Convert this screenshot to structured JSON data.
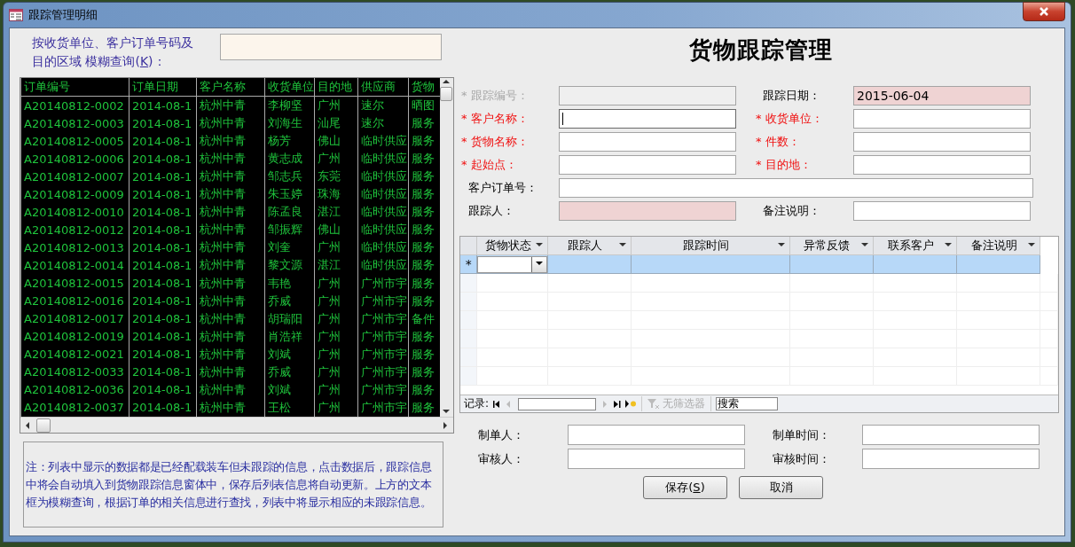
{
  "window": {
    "title": "跟踪管理明细"
  },
  "search": {
    "label_line1": "按收货单位、客户订单号码及",
    "label_before": "目的区域 模糊查询(",
    "mnemonic": "K",
    "label_after": ")："
  },
  "orders": {
    "columns": [
      "订单编号",
      "订单日期",
      "客户名称",
      "收货单位",
      "目的地",
      "供应商",
      "货物"
    ],
    "rows": [
      [
        "A20140812-0002",
        "2014-08-1",
        "杭州中青",
        "李柳坚",
        "广州",
        "速尔",
        "晒图"
      ],
      [
        "A20140812-0003",
        "2014-08-1",
        "杭州中青",
        "刘海生",
        "汕尾",
        "速尔",
        "服务"
      ],
      [
        "A20140812-0005",
        "2014-08-1",
        "杭州中青",
        "杨芳",
        "佛山",
        "临时供应",
        "服务"
      ],
      [
        "A20140812-0006",
        "2014-08-1",
        "杭州中青",
        "黄志成",
        "广州",
        "临时供应",
        "服务"
      ],
      [
        "A20140812-0007",
        "2014-08-1",
        "杭州中青",
        "邹志兵",
        "东莞",
        "临时供应",
        "服务"
      ],
      [
        "A20140812-0009",
        "2014-08-1",
        "杭州中青",
        "朱玉婷",
        "珠海",
        "临时供应",
        "服务"
      ],
      [
        "A20140812-0010",
        "2014-08-1",
        "杭州中青",
        "陈孟良",
        "湛江",
        "临时供应",
        "服务"
      ],
      [
        "A20140812-0012",
        "2014-08-1",
        "杭州中青",
        "邹振辉",
        "佛山",
        "临时供应",
        "服务"
      ],
      [
        "A20140812-0013",
        "2014-08-1",
        "杭州中青",
        "刘奎",
        "广州",
        "临时供应",
        "服务"
      ],
      [
        "A20140812-0014",
        "2014-08-1",
        "杭州中青",
        "黎文源",
        "湛江",
        "临时供应",
        "服务"
      ],
      [
        "A20140812-0015",
        "2014-08-1",
        "杭州中青",
        "韦艳",
        "广州",
        "广州市宇",
        "服务"
      ],
      [
        "A20140812-0016",
        "2014-08-1",
        "杭州中青",
        "乔威",
        "广州",
        "广州市宇",
        "服务"
      ],
      [
        "A20140812-0017",
        "2014-08-1",
        "杭州中青",
        "胡瑞阳",
        "广州",
        "广州市宇",
        "备件"
      ],
      [
        "A20140812-0019",
        "2014-08-1",
        "杭州中青",
        "肖浩祥",
        "广州",
        "广州市宇",
        "服务"
      ],
      [
        "A20140812-0021",
        "2014-08-1",
        "杭州中青",
        "刘斌",
        "广州",
        "广州市宇",
        "服务"
      ],
      [
        "A20140812-0033",
        "2014-08-1",
        "杭州中青",
        "乔威",
        "广州",
        "广州市宇",
        "服务"
      ],
      [
        "A20140812-0036",
        "2014-08-1",
        "杭州中青",
        "刘斌",
        "广州",
        "广州市宇",
        "服务"
      ],
      [
        "A20140812-0037",
        "2014-08-1",
        "杭州中青",
        "王松",
        "广州",
        "广州市宇",
        "服务"
      ]
    ]
  },
  "note": "注：列表中显示的数据都是已经配载装车但未跟踪的信息，点击数据后，跟踪信息中将会自动填入到货物跟踪信息窗体中，保存后列表信息将自动更新。上方的文本框为模糊查询，根据订单的相关信息进行查找，列表中将显示相应的未跟踪信息。",
  "heading": "货物跟踪管理",
  "form": [
    [
      {
        "label": "* 跟踪编号：",
        "required": true,
        "disabled": true,
        "highlighted": false,
        "focused": false
      },
      {
        "label": "跟踪日期：",
        "required": false,
        "disabled": false,
        "highlighted": true,
        "focused": false,
        "value": "2015-06-04"
      }
    ],
    [
      {
        "label": "* 客户名称：",
        "required": true,
        "disabled": false,
        "highlighted": false,
        "focused": true
      },
      {
        "label": "* 收货单位：",
        "required": true,
        "disabled": false,
        "highlighted": false,
        "focused": false
      }
    ],
    [
      {
        "label": "* 货物名称：",
        "required": true,
        "disabled": false,
        "highlighted": false,
        "focused": false
      },
      {
        "label": "* 件数：",
        "required": true,
        "disabled": false,
        "highlighted": false,
        "focused": false
      }
    ],
    [
      {
        "label": "* 起始点：",
        "required": true,
        "disabled": false,
        "highlighted": false,
        "focused": false
      },
      {
        "label": "* 目的地：",
        "required": true,
        "disabled": false,
        "highlighted": false,
        "focused": false
      }
    ],
    [
      {
        "label": "客户订单号：",
        "required": false,
        "disabled": false,
        "highlighted": false,
        "focused": false
      }
    ],
    [
      {
        "label": "跟踪人：",
        "required": false,
        "disabled": false,
        "highlighted": true,
        "focused": false
      },
      {
        "label": "备注说明：",
        "required": false,
        "disabled": false,
        "highlighted": false,
        "focused": false
      }
    ]
  ],
  "tracking": {
    "columns": [
      "货物状态",
      "跟踪人",
      "跟踪时间",
      "异常反馈",
      "联系客户",
      "备注说明"
    ],
    "new_row_marker": "*",
    "new_row_selected": true,
    "nav": {
      "label": "记录:",
      "filter": "无筛选器",
      "search": "搜索"
    }
  },
  "signoff": [
    {
      "label": "制单人："
    },
    {
      "label": "制单时间："
    },
    {
      "label": "审核人："
    },
    {
      "label": "审核时间："
    }
  ],
  "buttons": [
    {
      "before": "保存(",
      "mnemonic": "S",
      "after": ")"
    },
    {
      "before": "取消"
    }
  ]
}
